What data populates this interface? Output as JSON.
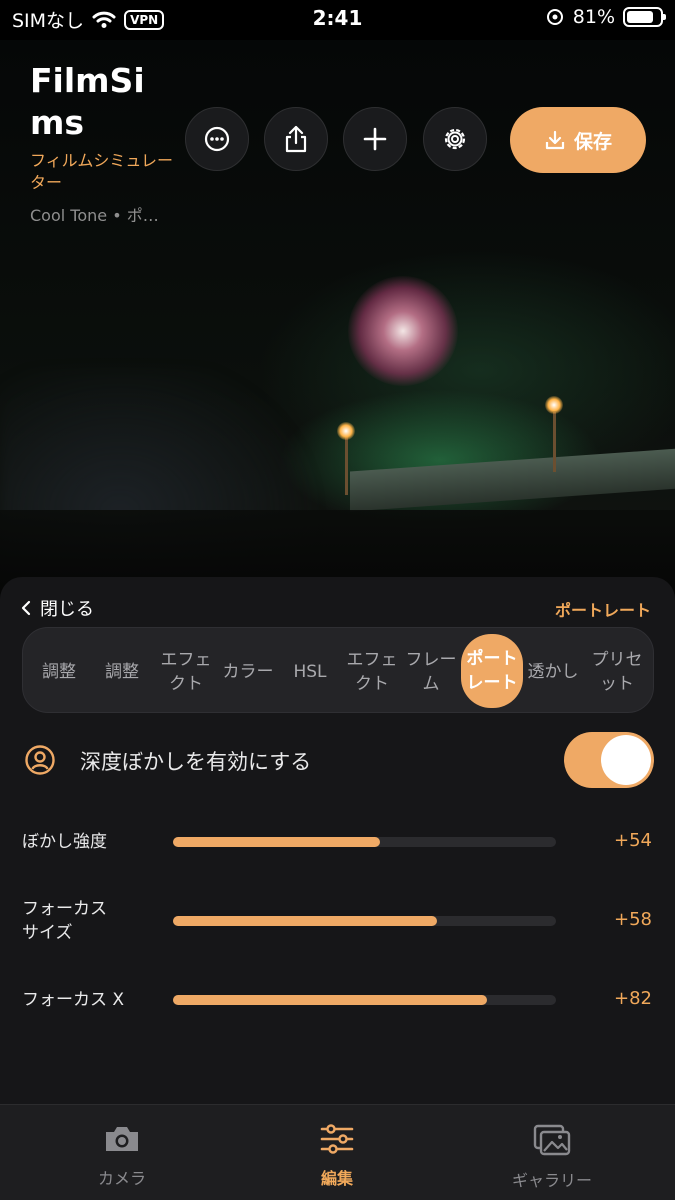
{
  "status_bar": {
    "carrier": "SIMなし",
    "vpn": "VPN",
    "time": "2:41",
    "battery": "81%",
    "battery_level": 0.81
  },
  "header": {
    "title": "FilmSims",
    "subtitle": "フィルムシミュレーター",
    "description": "Cool Tone • ポ…",
    "save_label": "保存",
    "icons": [
      "more-icon",
      "share-icon",
      "plus-icon",
      "gear-icon",
      "download-icon"
    ]
  },
  "panel": {
    "close_label": "閉じる",
    "mode_label": "ポートレート",
    "tabs": [
      {
        "label": "調整"
      },
      {
        "label": "調整"
      },
      {
        "label": "エフェクト"
      },
      {
        "label": "カラー"
      },
      {
        "label": "HSL"
      },
      {
        "label": "エフェクト"
      },
      {
        "label": "フレーム"
      },
      {
        "label": "ポートレート",
        "active": true
      },
      {
        "label": "透かし"
      },
      {
        "label": "プリセット"
      }
    ],
    "toggle": {
      "label": "深度ぼかしを有効にする",
      "on": true
    },
    "sliders": [
      {
        "label": "ぼかし強度",
        "value": "+54",
        "fraction": 0.54
      },
      {
        "label": "フォーカスサイズ",
        "value": "+58",
        "fraction": 0.69
      },
      {
        "label": "フォーカス X",
        "value": "+82",
        "fraction": 0.82
      }
    ]
  },
  "bottom_nav": [
    {
      "label": "カメラ",
      "icon": "camera-icon"
    },
    {
      "label": "編集",
      "icon": "sliders-icon",
      "active": true
    },
    {
      "label": "ギャラリー",
      "icon": "gallery-icon"
    }
  ],
  "colors": {
    "accent": "#efa965",
    "panel": "#161618",
    "nav": "#1e1e20"
  }
}
